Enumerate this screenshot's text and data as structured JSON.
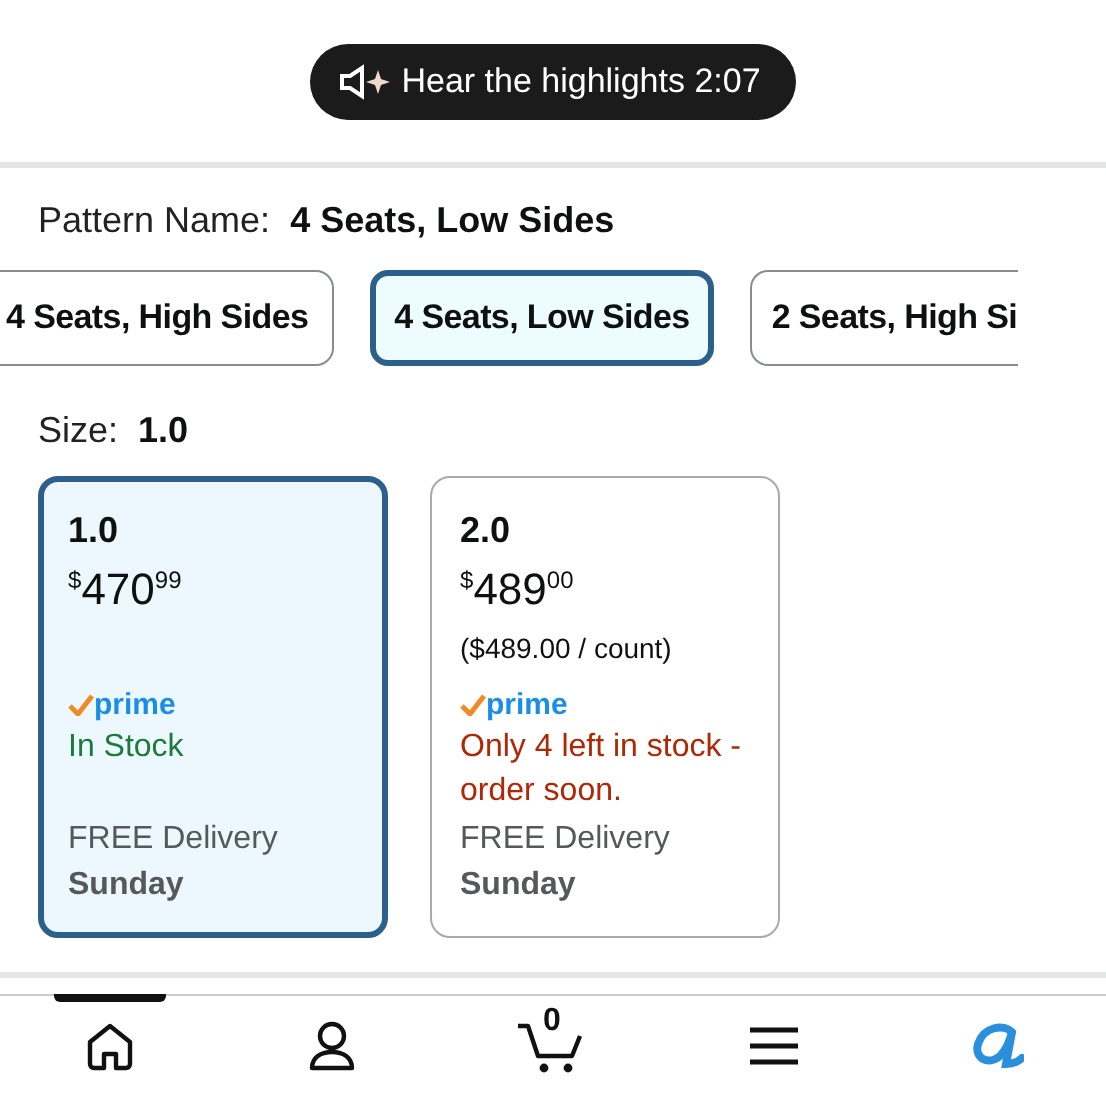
{
  "audio_pill": {
    "label": "Hear the highlights 2:07"
  },
  "pattern": {
    "label": "Pattern Name:",
    "value": "4 Seats, Low Sides"
  },
  "pattern_options": [
    {
      "label": "4 Seats, High Sides",
      "selected": false
    },
    {
      "label": "4 Seats, Low Sides",
      "selected": true
    },
    {
      "label": "2 Seats, High Si",
      "selected": false
    }
  ],
  "size": {
    "label": "Size:",
    "value": "1.0"
  },
  "size_options": [
    {
      "size": "1.0",
      "price_currency": "$",
      "price_whole": "470",
      "price_fraction": "99",
      "prime": "prime",
      "stock": "In Stock",
      "kind": "in_stock",
      "delivery": "FREE Delivery",
      "day": "Sunday",
      "selected": true
    },
    {
      "size": "2.0",
      "price_currency": "$",
      "price_whole": "489",
      "price_fraction": "00",
      "unit_price": "($489.00 / count)",
      "prime": "prime",
      "stock": "Only 4 left in stock - order soon.",
      "kind": "low_stock",
      "delivery": "FREE Delivery",
      "day": "Sunday",
      "selected": false
    }
  ],
  "nav": [
    {
      "kind": "home",
      "selected": true
    },
    {
      "kind": "account",
      "selected": false
    },
    {
      "kind": "cart",
      "count": "0",
      "selected": false
    },
    {
      "kind": "menu",
      "selected": false
    },
    {
      "kind": "assistant",
      "selected": false
    }
  ]
}
